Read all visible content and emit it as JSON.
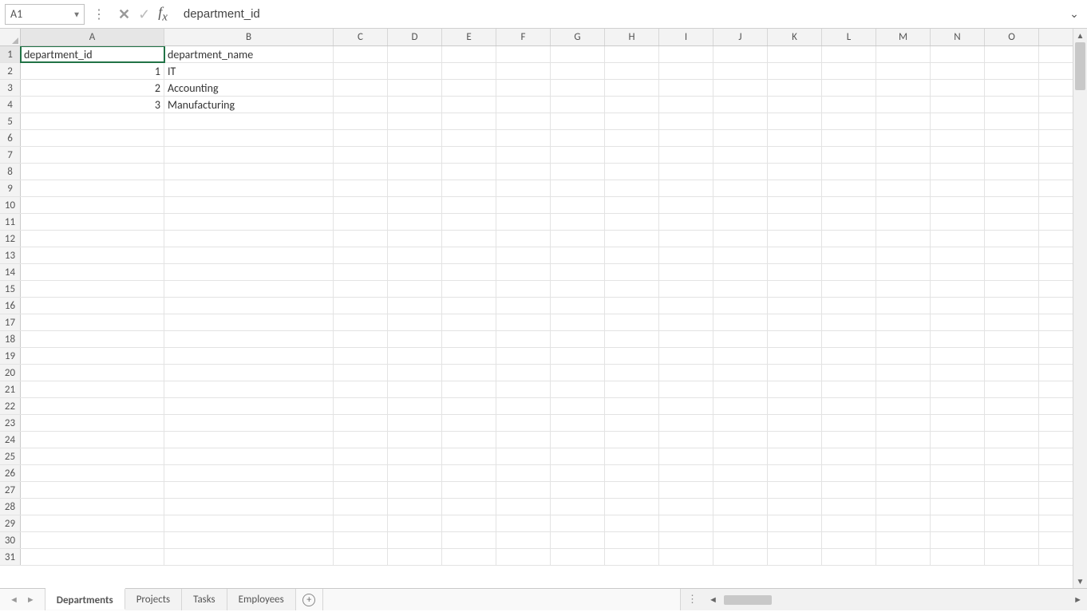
{
  "nameBox": "A1",
  "formulaBarValue": "department_id",
  "colHeaders": [
    "A",
    "B",
    "C",
    "D",
    "E",
    "F",
    "G",
    "H",
    "I",
    "J",
    "K",
    "L",
    "M",
    "N",
    "O"
  ],
  "rowCount": 31,
  "cells": {
    "A1": "department_id",
    "B1": "department_name",
    "A2": "1",
    "B2": "IT",
    "A3": "2",
    "B3": "Accounting",
    "A4": "3",
    "B4": "Manufacturing"
  },
  "selectedCell": "A1",
  "sheetTabs": [
    {
      "name": "Departments",
      "active": true
    },
    {
      "name": "Projects",
      "active": false
    },
    {
      "name": "Tasks",
      "active": false
    },
    {
      "name": "Employees",
      "active": false
    }
  ]
}
